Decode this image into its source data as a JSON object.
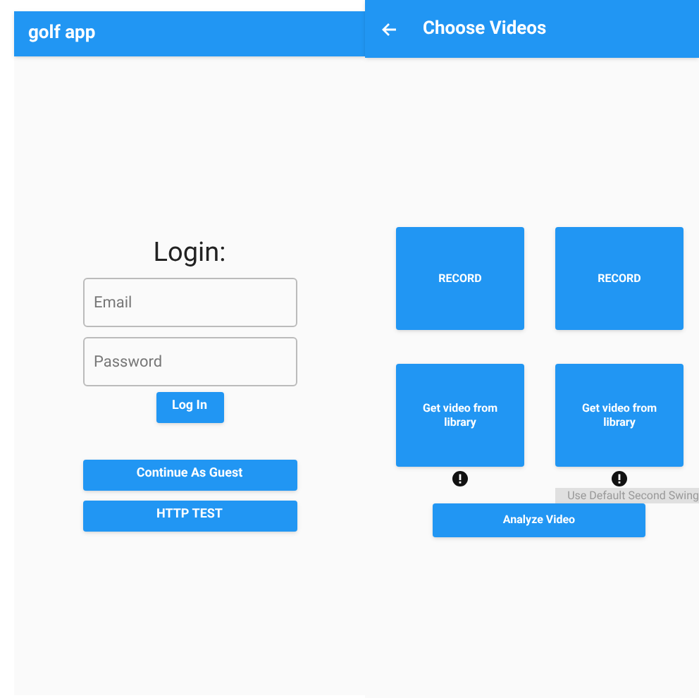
{
  "login_screen": {
    "app_bar": {
      "title": "golf app"
    },
    "heading": "Login:",
    "fields": [
      {
        "placeholder": "Email"
      },
      {
        "placeholder": "Password"
      }
    ],
    "login_button": "Log In",
    "buttons": [
      "Continue As Guest",
      "HTTP TEST"
    ]
  },
  "videos_screen": {
    "app_bar": {
      "title": "Choose Videos"
    },
    "tiles": [
      {
        "label": "RECORD",
        "alert": false
      },
      {
        "label": "RECORD",
        "alert": false
      },
      {
        "label": "Get video from library",
        "alert": true
      },
      {
        "label": "Get video from library",
        "alert": true
      }
    ],
    "default_swing_label": "Use Default Second Swing",
    "analyze_button": "Analyze Video"
  }
}
